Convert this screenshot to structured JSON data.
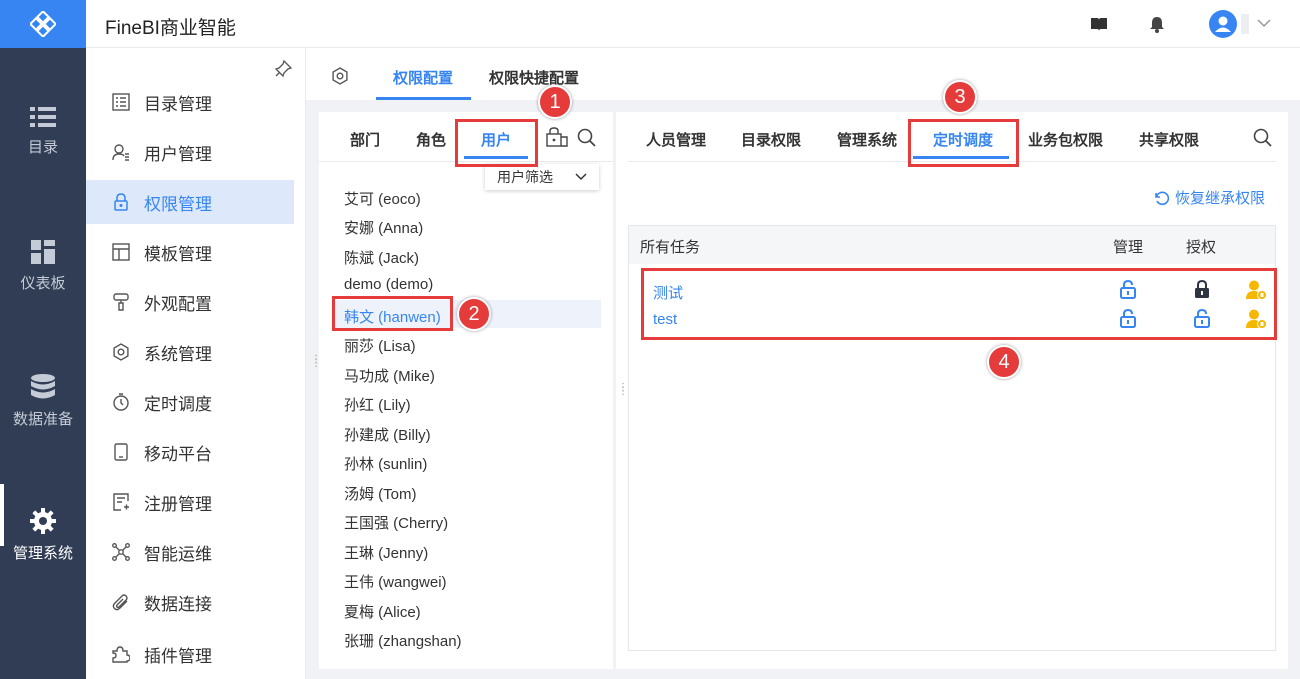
{
  "app": {
    "title": "FineBI商业智能"
  },
  "rail": [
    {
      "label": "目录",
      "icon": "list-icon"
    },
    {
      "label": "仪表板",
      "icon": "dashboard-icon"
    },
    {
      "label": "数据准备",
      "icon": "database-icon"
    },
    {
      "label": "管理系统",
      "icon": "gear-icon",
      "active": true
    }
  ],
  "menu": [
    {
      "label": "目录管理"
    },
    {
      "label": "用户管理"
    },
    {
      "label": "权限管理",
      "active": true
    },
    {
      "label": "模板管理"
    },
    {
      "label": "外观配置"
    },
    {
      "label": "系统管理"
    },
    {
      "label": "定时调度"
    },
    {
      "label": "移动平台"
    },
    {
      "label": "注册管理"
    },
    {
      "label": "智能运维"
    },
    {
      "label": "数据连接"
    },
    {
      "label": "插件管理"
    }
  ],
  "top_tabs": [
    {
      "label": "权限配置",
      "active": true
    },
    {
      "label": "权限快捷配置"
    }
  ],
  "left_tabs": [
    {
      "label": "部门"
    },
    {
      "label": "角色"
    },
    {
      "label": "用户",
      "active": true
    }
  ],
  "user_filter": "用户筛选",
  "users": [
    "艾可 (eoco)",
    "安娜 (Anna)",
    "陈斌 (Jack)",
    "demo (demo)",
    "韩文 (hanwen)",
    "丽莎 (Lisa)",
    "马功成 (Mike)",
    "孙红 (Lily)",
    "孙建成 (Billy)",
    "孙林 (sunlin)",
    "汤姆 (Tom)",
    "王国强 (Cherry)",
    "王琳 (Jenny)",
    "王伟 (wangwei)",
    "夏梅 (Alice)",
    "张珊 (zhangshan)"
  ],
  "selected_user_index": 4,
  "right_tabs": [
    {
      "label": "人员管理"
    },
    {
      "label": "目录权限"
    },
    {
      "label": "管理系统"
    },
    {
      "label": "定时调度",
      "active": true
    },
    {
      "label": "业务包权限"
    },
    {
      "label": "共享权限"
    }
  ],
  "restore": "恢复继承权限",
  "grid": {
    "col_tasks": "所有任务",
    "col_manage": "管理",
    "col_grant": "授权",
    "rows": [
      {
        "name": "测试",
        "manage": "unlocked",
        "grant": "locked"
      },
      {
        "name": "test",
        "manage": "unlocked",
        "grant": "unlocked"
      }
    ]
  },
  "badges": [
    "1",
    "2",
    "3",
    "4"
  ],
  "colors": {
    "accent": "#3685f2",
    "rail": "#303d54",
    "highlight": "#e53b3b"
  }
}
